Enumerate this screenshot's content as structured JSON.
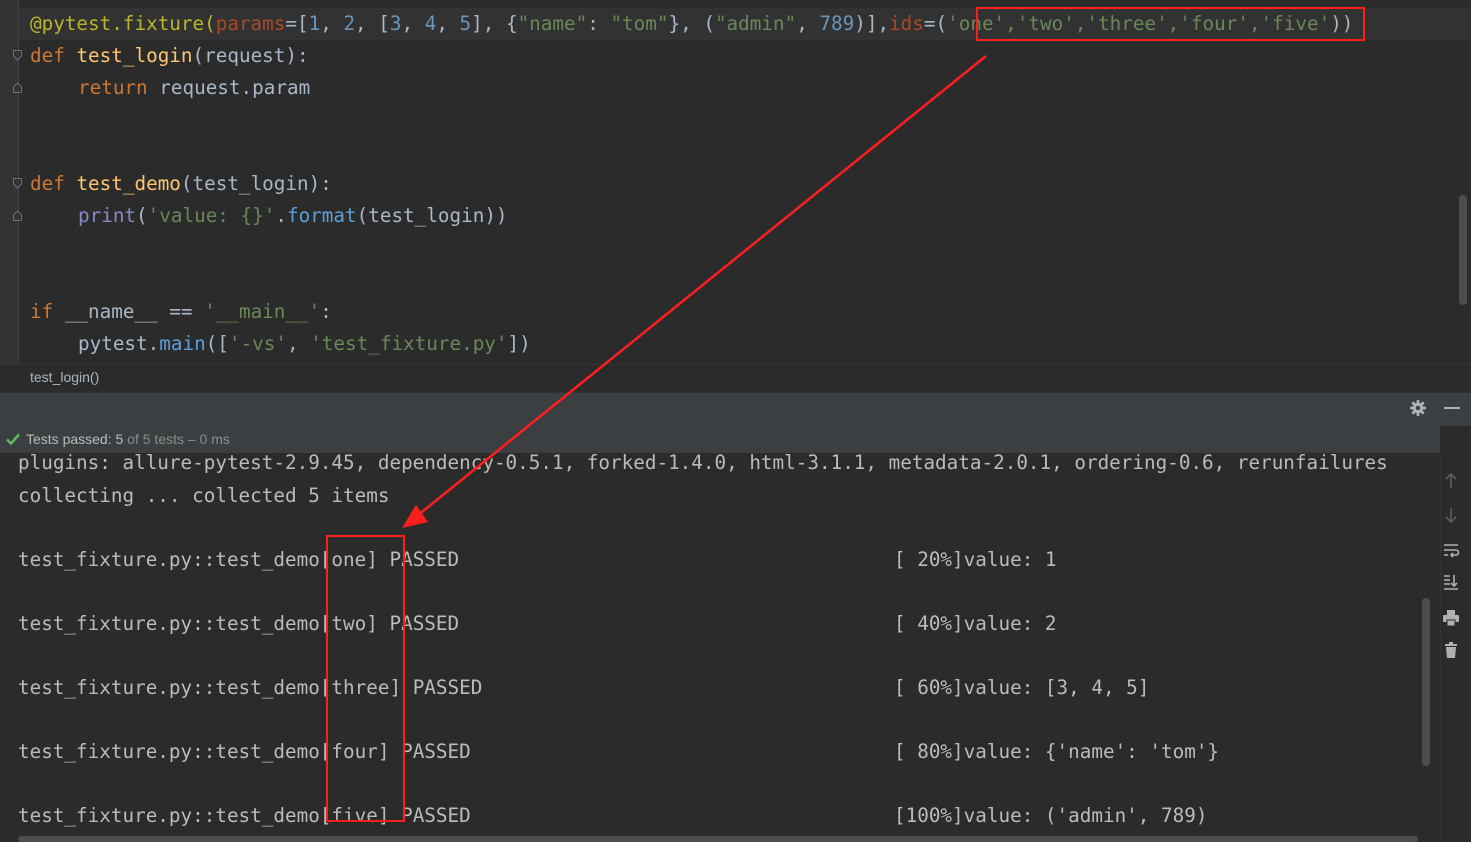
{
  "editor": {
    "line1": {
      "decorator": "@pytest.fixture(",
      "params_kw": "params",
      "eq1": "=[",
      "n1": "1",
      "c1": ", ",
      "n2": "2",
      "c2": ", [",
      "n3": "3",
      "c3": ", ",
      "n4": "4",
      "c4": ", ",
      "n5": "5",
      "c5": "], {",
      "s_name": "\"name\"",
      "colon": ": ",
      "s_tom": "\"tom\"",
      "c6": "}, (",
      "s_admin": "\"admin\"",
      "c7": ", ",
      "n789": "789",
      "c8": ")],",
      "ids_kw": "ids",
      "eq2": "=(",
      "ids_values": "'one','two','three','four','five'",
      "close": "))"
    },
    "line2": {
      "kw": "def ",
      "name": "test_login",
      "rest": "(request):"
    },
    "line3": {
      "kw": "return ",
      "rest": "request.param"
    },
    "line4": {
      "kw": "def ",
      "name": "test_demo",
      "rest": "(test_login):"
    },
    "line5": {
      "call": "print",
      "open": "(",
      "str": "'value: {}'",
      "dot": ".",
      "meth": "format",
      "rest": "(test_login))"
    },
    "line6": {
      "kw": "if ",
      "rest1": "__name__ == ",
      "str": "'__main__'",
      "rest2": ":"
    },
    "line7": {
      "rest1": "pytest.",
      "meth": "main",
      "rest2": "([",
      "s1": "'-vs'",
      "c": ", ",
      "s2": "'test_fixture.py'",
      "rest3": "])"
    }
  },
  "breadcrumb": "test_login()",
  "run": {
    "status_label": "Tests passed: ",
    "status_count": "5",
    "status_rest": " of 5 tests – 0 ms",
    "console": {
      "plugins": "plugins: allure-pytest-2.9.45, dependency-0.5.1, forked-1.4.0, html-3.1.1, metadata-2.0.1, ordering-0.6, rerunfailures",
      "collecting": "collecting ... collected 5 items",
      "results": [
        {
          "prefix": "test_fixture.py::test_demo",
          "id": "[one]",
          "status": " PASSED",
          "progress": "[ 20%]",
          "output": "value: 1"
        },
        {
          "prefix": "test_fixture.py::test_demo",
          "id": "[two]",
          "status": " PASSED",
          "progress": "[ 40%]",
          "output": "value: 2"
        },
        {
          "prefix": "test_fixture.py::test_demo",
          "id": "[three]",
          "status": " PASSED",
          "progress": "[ 60%]",
          "output": "value: [3, 4, 5]"
        },
        {
          "prefix": "test_fixture.py::test_demo",
          "id": "[four]",
          "status": " PASSED",
          "progress": "[ 80%]",
          "output": "value: {'name': 'tom'}"
        },
        {
          "prefix": "test_fixture.py::test_demo",
          "id": "[five]",
          "status": " PASSED",
          "progress": "[100%]",
          "output": "value: ('admin', 789)"
        }
      ]
    }
  },
  "icons": {
    "gear": "gear-icon",
    "minimize": "minimize-icon",
    "check": "check-icon",
    "up": "arrow-up-icon",
    "down": "arrow-down-icon",
    "wrap": "soft-wrap-icon",
    "scroll_end": "scroll-to-end-icon",
    "print": "print-icon",
    "trash": "trash-icon"
  },
  "colors": {
    "annotation": "#ff1e1e",
    "pass_check": "#5fb760"
  }
}
